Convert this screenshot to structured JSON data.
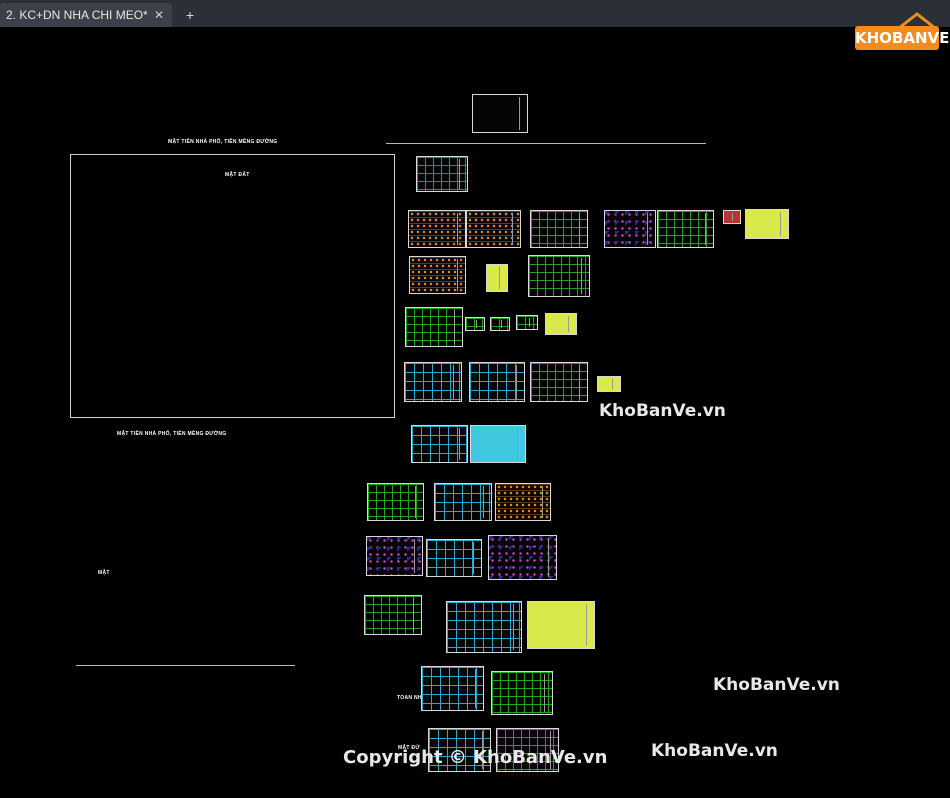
{
  "tab": {
    "title": "2. KC+DN NHA CHI MEO*",
    "close": "✕",
    "add": "+"
  },
  "labels": {
    "top_title": "MẶT TIỀN NHÀ PHỐ, TIÊN MỀNG ĐƯỜNG",
    "frame_caption": "MẶT ĐẤT",
    "bottom_title": "MẶT TIỀN NHÀ PHỐ, TIÊN MỀNG ĐƯỜNG",
    "left_small": "MẶT",
    "side_a": "TOAN NHÀ",
    "side_b": "MẶT ĐỨ"
  },
  "logo": {
    "text": "KHOBANVE"
  },
  "watermarks": [
    "KhoBanVe.vn",
    "KhoBanVe.vn",
    "KhoBanVe.vn",
    "Copyright © KhoBanVe.vn"
  ]
}
